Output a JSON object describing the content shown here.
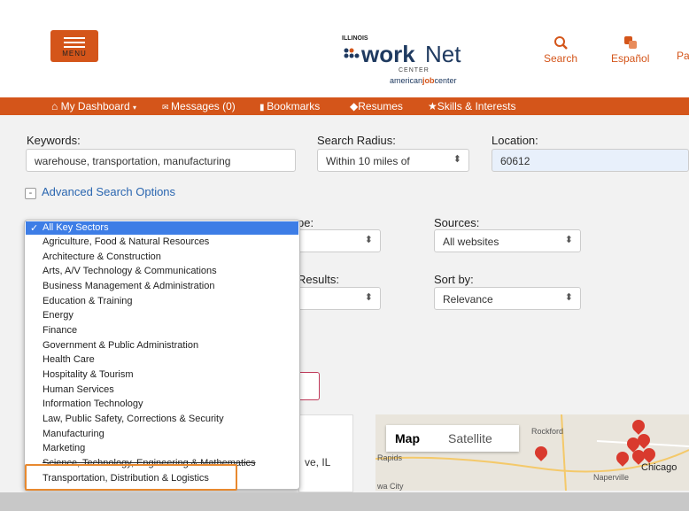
{
  "header": {
    "menu_label": "MENU",
    "logo_illinois": "ILLINOIS",
    "logo_work": "work",
    "logo_net": "Net",
    "logo_center": "CENTER",
    "logo_ajc_pre": "american",
    "logo_ajc_bold": "job",
    "logo_ajc_post": "center",
    "search_label": "Search",
    "espanol_label": "Español",
    "partial_label": "Pa"
  },
  "navbar": {
    "dashboard": "My Dashboard",
    "messages": "Messages (0)",
    "bookmarks": "Bookmarks",
    "resumes": "Resumes",
    "skills": "Skills & Interests"
  },
  "search": {
    "keywords_label": "Keywords:",
    "keywords_value": "warehouse, transportation, manufacturing",
    "radius_label": "Search Radius:",
    "radius_value": "Within 10 miles of",
    "location_label": "Location:",
    "location_value": "60612",
    "advanced_label": "Advanced Search Options",
    "type_label_partial": "pe:",
    "sources_label": "Sources:",
    "sources_value": "All websites",
    "results_label_partial": "Results:",
    "sortby_label": "Sort by:",
    "sortby_value": "Relevance"
  },
  "sectors": {
    "selected": "All Key Sectors",
    "items": [
      "Agriculture, Food & Natural Resources",
      "Architecture & Construction",
      "Arts, A/V Technology & Communications",
      "Business Management & Administration",
      "Education & Training",
      "Energy",
      "Finance",
      "Government & Public Administration",
      "Health Care",
      "Hospitality & Tourism",
      "Human Services",
      "Information Technology",
      "Law, Public Safety, Corrections & Security",
      "Manufacturing",
      "Marketing",
      "Science, Technology, Engineering & Mathematics",
      "Transportation, Distribution & Logistics"
    ]
  },
  "results": {
    "card_partial_text": "ve, IL"
  },
  "map": {
    "tab_map": "Map",
    "tab_satellite": "Satellite",
    "label_rockford": "Rockford",
    "label_rapids": "Rapids",
    "label_city": "wa City",
    "label_naperville": "Naperville",
    "label_chicago": "Chicago"
  },
  "colors": {
    "brand_orange": "#d4551a",
    "highlight_orange": "#e8892f",
    "selected_blue": "#3d7de6",
    "link_blue": "#2a66b0"
  }
}
